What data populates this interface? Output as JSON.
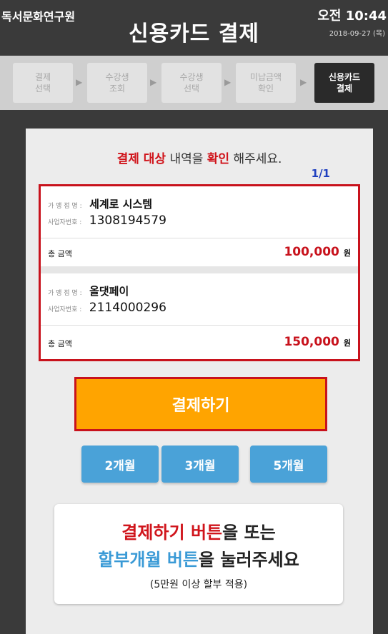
{
  "header": {
    "org_name": "독서문화연구원",
    "title": "신용카드 결제",
    "time": "오전 10:44",
    "date": "2018-09-27 (목)"
  },
  "steps": [
    {
      "line1": "결제",
      "line2": "선택",
      "active": false
    },
    {
      "line1": "수강생",
      "line2": "조회",
      "active": false
    },
    {
      "line1": "수강생",
      "line2": "선택",
      "active": false
    },
    {
      "line1": "미납금액",
      "line2": "확인",
      "active": false
    },
    {
      "line1": "신용카드",
      "line2": "결제",
      "active": true
    }
  ],
  "notice": {
    "part1": "결제 대상",
    "part2": " 내역을 ",
    "part3": "확인",
    "part4": " 해주세요."
  },
  "pager": "1/1",
  "items": [
    {
      "merchant_label": "가 맹 점 명 :",
      "merchant": "세계로 시스템",
      "bizno_label": "사업자번호 :",
      "bizno": "1308194579",
      "total_label": "총 금액",
      "total": "100,000",
      "currency": "원"
    },
    {
      "merchant_label": "가 맹 점 명 :",
      "merchant": "올댓페이",
      "bizno_label": "사업자번호 :",
      "bizno": "2114000296",
      "total_label": "총 금액",
      "total": "150,000",
      "currency": "원"
    }
  ],
  "pay_button": "결제하기",
  "installments": [
    "2개월",
    "3개월",
    "5개월"
  ],
  "guide": {
    "line1_red": "결제하기 버튼",
    "line1_rest": "을 또는",
    "line2_blue": "할부개월 버튼",
    "line2_rest": "을 눌러주세요",
    "line3": "(5만원 이상 할부 적용)"
  },
  "colors": {
    "accent_red": "#c8121c",
    "pay_orange": "#ffa400",
    "installment_blue": "#4aa2d8",
    "header_dark": "#3a3a3a"
  }
}
